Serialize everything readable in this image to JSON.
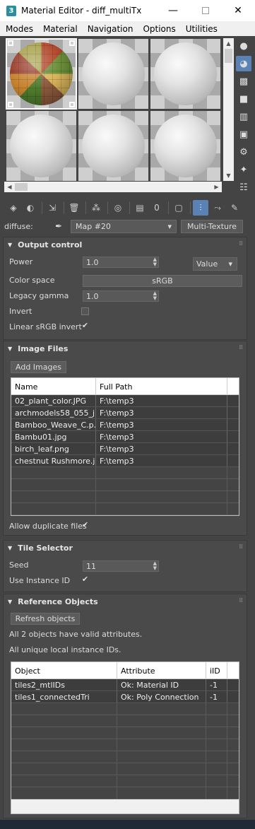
{
  "window": {
    "app_icon": "3",
    "title": "Material Editor - diff_multiTx",
    "min": "—",
    "close": "✕"
  },
  "menu": {
    "modes": "Modes",
    "material": "Material",
    "navigation": "Navigation",
    "options": "Options",
    "utilities": "Utilities"
  },
  "map_row": {
    "label": "diffuse:",
    "map_name": "Map #20",
    "map_type": "Multi-Texture"
  },
  "output_control": {
    "header": "Output control",
    "power_label": "Power",
    "power_value": "1.0",
    "power_mode": "Value",
    "color_space_label": "Color space",
    "color_space_value": "sRGB",
    "legacy_gamma_label": "Legacy gamma",
    "legacy_gamma_value": "1.0",
    "invert_label": "Invert",
    "invert_checked": false,
    "linear_label": "Linear sRGB invert",
    "linear_checked": true
  },
  "image_files": {
    "header": "Image Files",
    "add_button": "Add Images",
    "columns": [
      "Name",
      "Full Path"
    ],
    "rows": [
      [
        "02_plant_color.JPG",
        "F:\\temp3"
      ],
      [
        "archmodels58_055_j...",
        "F:\\temp3"
      ],
      [
        "Bamboo_Weave_C.p...",
        "F:\\temp3"
      ],
      [
        "Bambu01.jpg",
        "F:\\temp3"
      ],
      [
        "birch_leaf.png",
        "F:\\temp3"
      ],
      [
        "chestnut Rushmore.jpg",
        "F:\\temp3"
      ]
    ],
    "allow_duplicates_label": "Allow duplicate files",
    "allow_duplicates_checked": true
  },
  "tile_selector": {
    "header": "Tile Selector",
    "seed_label": "Seed",
    "seed_value": "11",
    "use_instance_label": "Use Instance ID",
    "use_instance_checked": true
  },
  "reference_objects": {
    "header": "Reference Objects",
    "refresh_button": "Refresh objects",
    "status_1": "All 2 objects have valid attributes.",
    "status_2": "All unique local instance IDs.",
    "columns": [
      "Object",
      "Attribute",
      "iID"
    ],
    "rows": [
      [
        "tiles2_mtlIDs",
        "Ok: Material ID",
        "-1"
      ],
      [
        "tiles1_connectedTri",
        "Ok: Poly Connection",
        "-1"
      ]
    ]
  },
  "icons": {
    "side": [
      "sphere-sample-icon",
      "backlight-icon",
      "background-checker-icon",
      "sample-uv-tiling-icon",
      "video-color-check-icon",
      "make-preview-icon",
      "options-icon",
      "select-by-material-icon",
      "material-map-navigator-icon"
    ],
    "toolbar": [
      "get-material-icon",
      "put-to-scene-icon",
      "assign-to-selection-icon",
      "reset-map-icon",
      "make-unique-icon",
      "put-to-library-icon",
      "material-id-channel-icon",
      "show-shaded-material-icon",
      "show-end-result-icon",
      "go-to-parent-icon",
      "go-forward-to-sibling-icon"
    ]
  }
}
